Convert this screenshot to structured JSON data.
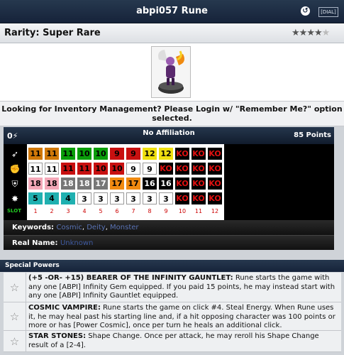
{
  "title": "abpi057 Rune",
  "dial_button": "[DIAL]",
  "rarity": "Rarity: Super Rare",
  "stars": {
    "filled": 4,
    "total": 5
  },
  "login_notice": "Looking for Inventory Management? Please Login w/ \"Remember Me?\" option selected.",
  "dial_header": {
    "icon": "0",
    "affiliation": "No Affiliation",
    "points": "85 Points"
  },
  "stats": [
    {
      "icon": "speed-icon",
      "cells": [
        [
          "11",
          "#d07808",
          "#000"
        ],
        [
          "11",
          "#d07808",
          "#000"
        ],
        [
          "11",
          "#0a9e0a",
          "#000"
        ],
        [
          "10",
          "#0a9e0a",
          "#000"
        ],
        [
          "10",
          "#0a9e0a",
          "#000"
        ],
        [
          "9",
          "#c81010",
          "#000"
        ],
        [
          "9",
          "#c81010",
          "#000"
        ],
        [
          "12",
          "#f0e010",
          "#000"
        ],
        [
          "12",
          "#f0e010",
          "#000"
        ],
        [
          "KO",
          "#000",
          "#e01010"
        ],
        [
          "KO",
          "#000",
          "#e01010"
        ],
        [
          "KO",
          "#000",
          "#e01010"
        ]
      ]
    },
    {
      "icon": "attack-icon",
      "cells": [
        [
          "11",
          "#fff",
          "#000"
        ],
        [
          "11",
          "#fff",
          "#000"
        ],
        [
          "11",
          "#c81010",
          "#000"
        ],
        [
          "11",
          "#c81010",
          "#000"
        ],
        [
          "10",
          "#c81010",
          "#000"
        ],
        [
          "10",
          "#c81010",
          "#000"
        ],
        [
          "9",
          "#fff",
          "#000"
        ],
        [
          "9",
          "#fff",
          "#000"
        ],
        [
          "KO",
          "#000",
          "#e01010"
        ],
        [
          "KO",
          "#000",
          "#e01010"
        ],
        [
          "KO",
          "#000",
          "#e01010"
        ],
        [
          "KO",
          "#000",
          "#e01010"
        ]
      ]
    },
    {
      "icon": "defense-icon",
      "cells": [
        [
          "18",
          "#f4a8b8",
          "#000"
        ],
        [
          "18",
          "#f4a8b8",
          "#000"
        ],
        [
          "18",
          "#777",
          "#fff"
        ],
        [
          "18",
          "#777",
          "#fff"
        ],
        [
          "17",
          "#777",
          "#fff"
        ],
        [
          "17",
          "#f08a10",
          "#000"
        ],
        [
          "17",
          "#f08a10",
          "#000"
        ],
        [
          "16",
          "#000",
          "#fff"
        ],
        [
          "16",
          "#000",
          "#fff"
        ],
        [
          "KO",
          "#000",
          "#e01010"
        ],
        [
          "KO",
          "#000",
          "#e01010"
        ],
        [
          "KO",
          "#000",
          "#e01010"
        ]
      ]
    },
    {
      "icon": "damage-icon",
      "cells": [
        [
          "5",
          "#20b0b0",
          "#000"
        ],
        [
          "4",
          "#20b0b0",
          "#000"
        ],
        [
          "4",
          "#20b0b0",
          "#000"
        ],
        [
          "3",
          "#fff",
          "#000"
        ],
        [
          "3",
          "#fff",
          "#000"
        ],
        [
          "3",
          "#fff",
          "#000"
        ],
        [
          "3",
          "#fff",
          "#000"
        ],
        [
          "3",
          "#fff",
          "#000"
        ],
        [
          "3",
          "#fff",
          "#000"
        ],
        [
          "KO",
          "#000",
          "#e01010"
        ],
        [
          "KO",
          "#000",
          "#e01010"
        ],
        [
          "KO",
          "#000",
          "#e01010"
        ]
      ]
    }
  ],
  "slot_label": "SLOT",
  "slots": [
    "1",
    "2",
    "3",
    "4",
    "5",
    "6",
    "7",
    "8",
    "9",
    "10",
    "11",
    "12"
  ],
  "keywords_label": "Keywords:",
  "keywords": [
    "Cosmic",
    "Deity",
    "Monster"
  ],
  "real_name_label": "Real Name:",
  "real_name": "Unknown",
  "special_powers_label": "Special Powers",
  "powers": [
    {
      "name": "(+5 -OR- +15) BEARER OF THE INFINITY GAUNTLET:",
      "text": " Rune starts the game with any one [ABPI] Infinity Gem equipped. If you paid 15 points, he may instead start with any one [ABPI] Infinity Gauntlet equipped."
    },
    {
      "name": "COSMIC VAMPIRE:",
      "text": " Rune starts the game on click #4. Steal Energy. When Rune uses it, he may heal past his starting line and, if a hit opposing character was 100 points or more or has [Power Cosmic], once per turn he heals an additional click."
    },
    {
      "name": "STAR STONES:",
      "text": " Shape Change. Once per attack, he may reroll his Shape Change result of a [2-4]."
    }
  ]
}
